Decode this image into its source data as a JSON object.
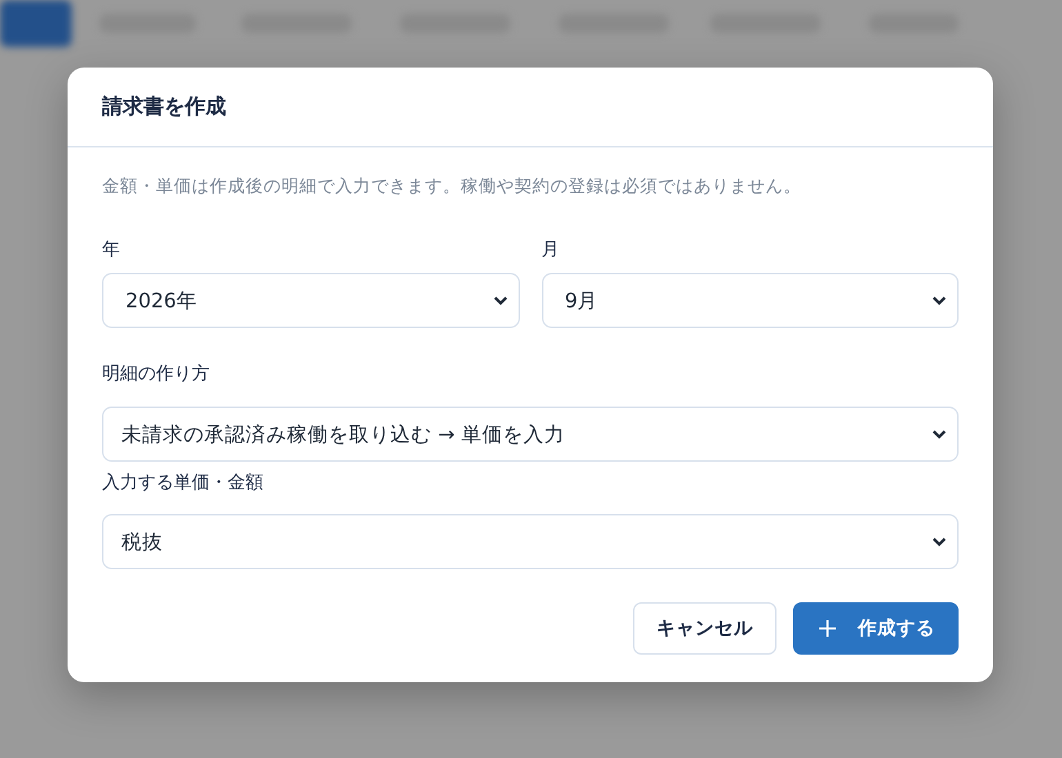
{
  "dialog": {
    "title": "請求書を作成",
    "description": "金額・単価は作成後の明細で入力できます。稼働や契約の登録は必須ではありません。",
    "date_fields": [
      {
        "label": "年",
        "value": "2026年"
      },
      {
        "label": "月",
        "value": "9月"
      }
    ],
    "fields": [
      {
        "label": "明細の作り方",
        "value": "未請求の承認済み稼働を取り込む → 単価を入力"
      },
      {
        "label": "入力する単価・金額",
        "value": "税抜"
      }
    ],
    "buttons": [
      {
        "kind": "secondary",
        "label": "キャンセル"
      },
      {
        "kind": "primary",
        "label": "作成する"
      }
    ]
  }
}
